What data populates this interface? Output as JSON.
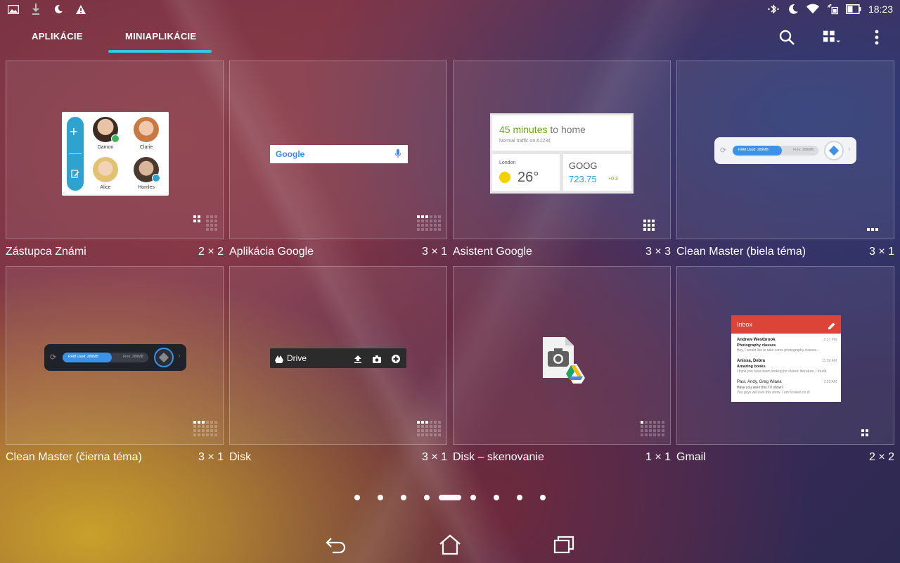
{
  "status_bar": {
    "time": "18:23",
    "left_icons": [
      "image-icon",
      "download-icon",
      "moon-icon",
      "warning-icon"
    ],
    "right_icons": [
      "bluetooth-icon",
      "moon-icon",
      "wifi-icon",
      "signal-icon",
      "battery-icon"
    ]
  },
  "tabs": [
    {
      "label": "APLIKÁCIE",
      "active": false
    },
    {
      "label": "MINIAPLIKÁCIE",
      "active": true
    }
  ],
  "accent_color": "#3fc3d3",
  "widgets": [
    {
      "label": "Zástupca Známi",
      "size": "2 × 2"
    },
    {
      "label": "Aplikácia Google",
      "size": "3 × 1"
    },
    {
      "label": "Asistent Google",
      "size": "3 × 3"
    },
    {
      "label": "Clean Master (biela téma)",
      "size": "3 × 1"
    },
    {
      "label": "Clean Master (čierna téma)",
      "size": "3 × 1"
    },
    {
      "label": "Disk",
      "size": "3 × 1"
    },
    {
      "label": "Disk – skenovanie",
      "size": "1 × 1"
    },
    {
      "label": "Gmail",
      "size": "2 × 2"
    }
  ],
  "contacts_preview": {
    "names": [
      "Damon",
      "Clarie",
      "Alice",
      "Homles"
    ]
  },
  "google_preview": {
    "logo": "Google"
  },
  "assistant_preview": {
    "commute_time": "45 minutes",
    "commute_suffix": " to home",
    "traffic": "Normal traffic on A1234",
    "city": "London",
    "temperature": "26°",
    "ticker": "GOOG",
    "price": "723.75",
    "change": "+0.3"
  },
  "cleanmaster_preview": {
    "ram_used": "RAM Used: 289MB",
    "free": "Free: 289MB"
  },
  "drive_preview": {
    "title": "Drive"
  },
  "gmail_preview": {
    "header": "Inbox",
    "messages": [
      {
        "from": "Andrew Westbrook",
        "time": "2:37 PM",
        "subject": "Photography classes",
        "snippet": "Hey, I would like to take some photography classes..."
      },
      {
        "from": "Anissa, Debra",
        "time": "11:59 AM",
        "subject": "Amazing books",
        "snippet": "I think you have been looking for classic literature. I found"
      },
      {
        "from": "Paul, Andy, Greg Wiana",
        "time": "2:53 AM",
        "subject": "",
        "snippet": "Have you seen this TV show?",
        "snippet2": "You guys will love this show. I am hooked on it!"
      }
    ]
  },
  "page_indicator": {
    "count": 9,
    "active_index": 4
  },
  "nav_icons": [
    "back-icon",
    "home-icon",
    "recents-icon"
  ]
}
